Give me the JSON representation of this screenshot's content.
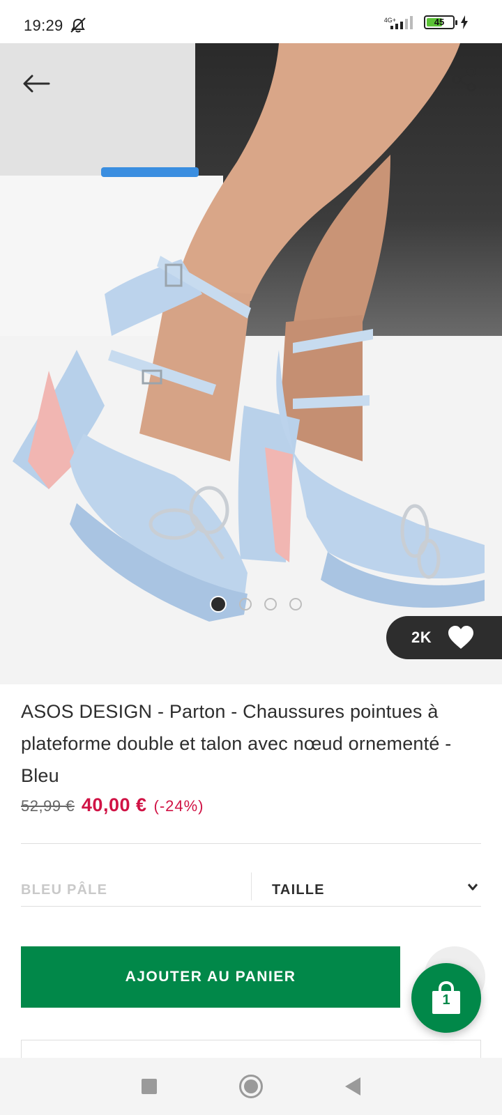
{
  "status_bar": {
    "time": "19:29",
    "network": "4G+",
    "battery": "45"
  },
  "icons": {
    "back": "arrow-left-icon",
    "share": "share-icon",
    "like": "heart-icon",
    "bag": "shopping-bag-icon",
    "size_dropdown": "chevron-down-icon"
  },
  "gallery": {
    "image_description": "Light blue satin pointed platform heels with embellished bows",
    "slides_total": 4,
    "active_slide": 1,
    "likes": "2K"
  },
  "product": {
    "title": "ASOS DESIGN - Parton - Chaussures pointues à plateforme double et talon avec nœud ornementé - Bleu",
    "old_price": "52,99 €",
    "price": "40,00 €",
    "discount": "(-24%)"
  },
  "options": {
    "colour": "BLEU PÂLE",
    "size_label": "TAILLE"
  },
  "actions": {
    "add_to_bag": "AJOUTER AU PANIER",
    "bag_count": "1"
  },
  "colors": {
    "accent_green": "#018849",
    "sale_red": "#d01345",
    "dark": "#2d2d2d"
  }
}
